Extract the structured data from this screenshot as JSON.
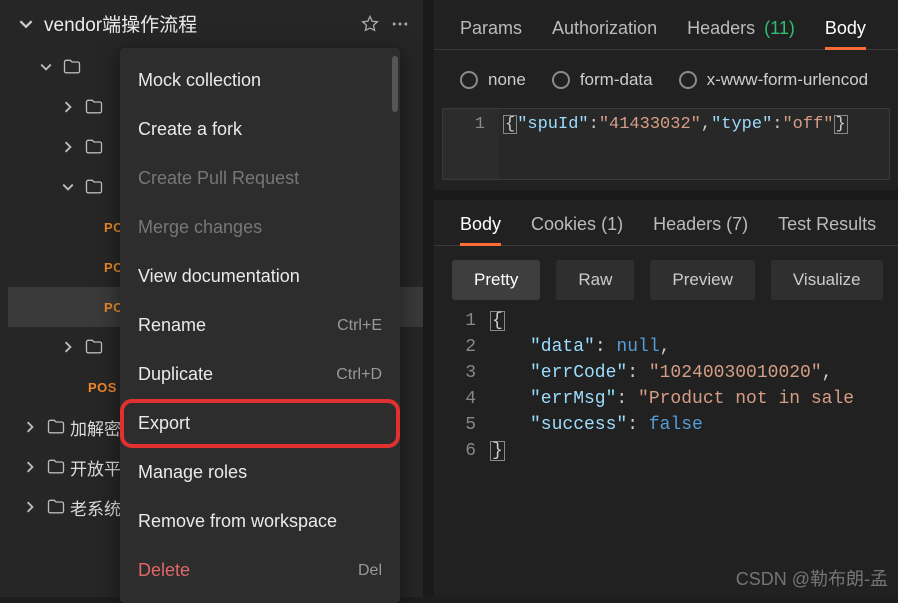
{
  "sidebar": {
    "collection_title": "vendor端操作流程",
    "tree": [
      {
        "type": "folder",
        "level": 1,
        "expanded": true,
        "label": ""
      },
      {
        "type": "folder",
        "level": 2,
        "expanded": false,
        "label": ""
      },
      {
        "type": "folder",
        "level": 2,
        "expanded": false,
        "label": ""
      },
      {
        "type": "folder",
        "level": 2,
        "expanded": true,
        "label": ""
      },
      {
        "type": "request",
        "level": 3,
        "method": "PO",
        "highlighted": false
      },
      {
        "type": "request",
        "level": 3,
        "method": "PO",
        "highlighted": false
      },
      {
        "type": "request",
        "level": 3,
        "method": "PO",
        "highlighted": true
      },
      {
        "type": "folder",
        "level": 2,
        "expanded": false,
        "label": ""
      },
      {
        "type": "request",
        "level": 2,
        "method": "POS",
        "highlighted": false
      },
      {
        "type": "folder",
        "level": 0,
        "expanded": false,
        "label": "加解密 "
      },
      {
        "type": "folder",
        "level": 0,
        "expanded": false,
        "label": "开放平台"
      },
      {
        "type": "folder",
        "level": 0,
        "expanded": false,
        "label": "老系统-"
      }
    ]
  },
  "context_menu": {
    "items": [
      {
        "label": "Mock collection",
        "disabled": false
      },
      {
        "label": "Create a fork",
        "disabled": false
      },
      {
        "label": "Create Pull Request",
        "disabled": true
      },
      {
        "label": "Merge changes",
        "disabled": true
      },
      {
        "label": "View documentation",
        "disabled": false
      },
      {
        "label": "Rename",
        "shortcut": "Ctrl+E",
        "disabled": false
      },
      {
        "label": "Duplicate",
        "shortcut": "Ctrl+D",
        "disabled": false
      },
      {
        "label": "Export",
        "highlighted": true,
        "disabled": false
      },
      {
        "label": "Manage roles",
        "disabled": false
      },
      {
        "label": "Remove from workspace",
        "disabled": false
      },
      {
        "label": "Delete",
        "shortcut": "Del",
        "danger": true,
        "disabled": false
      }
    ]
  },
  "main": {
    "req_tabs": [
      {
        "label": "Params"
      },
      {
        "label": "Authorization"
      },
      {
        "label": "Headers",
        "count": "(11)"
      },
      {
        "label": "Body",
        "active": true
      }
    ],
    "body_options": [
      {
        "label": "none"
      },
      {
        "label": "form-data"
      },
      {
        "label": "x-www-form-urlencod"
      }
    ],
    "req_body_line_no": "1",
    "req_body": {
      "k1": "\"spuId\"",
      "v1": "\"41433032\"",
      "k2": "\"type\"",
      "v2": "\"off\""
    },
    "resp_tabs": [
      {
        "label": "Body",
        "active": true
      },
      {
        "label": "Cookies",
        "count": "(1)"
      },
      {
        "label": "Headers",
        "count": "(7)"
      },
      {
        "label": "Test Results"
      }
    ],
    "resp_format": [
      {
        "label": "Pretty",
        "active": true
      },
      {
        "label": "Raw"
      },
      {
        "label": "Preview"
      },
      {
        "label": "Visualize"
      }
    ],
    "resp_lines": [
      "1",
      "2",
      "3",
      "4",
      "5",
      "6"
    ],
    "resp_body": {
      "data_k": "\"data\"",
      "data_v": "null",
      "err_k": "\"errCode\"",
      "err_v": "\"10240030010020\"",
      "msg_k": "\"errMsg\"",
      "msg_v": "\"Product not in sale",
      "suc_k": "\"success\"",
      "suc_v": "false"
    }
  },
  "watermark": "CSDN @勒布朗-孟"
}
